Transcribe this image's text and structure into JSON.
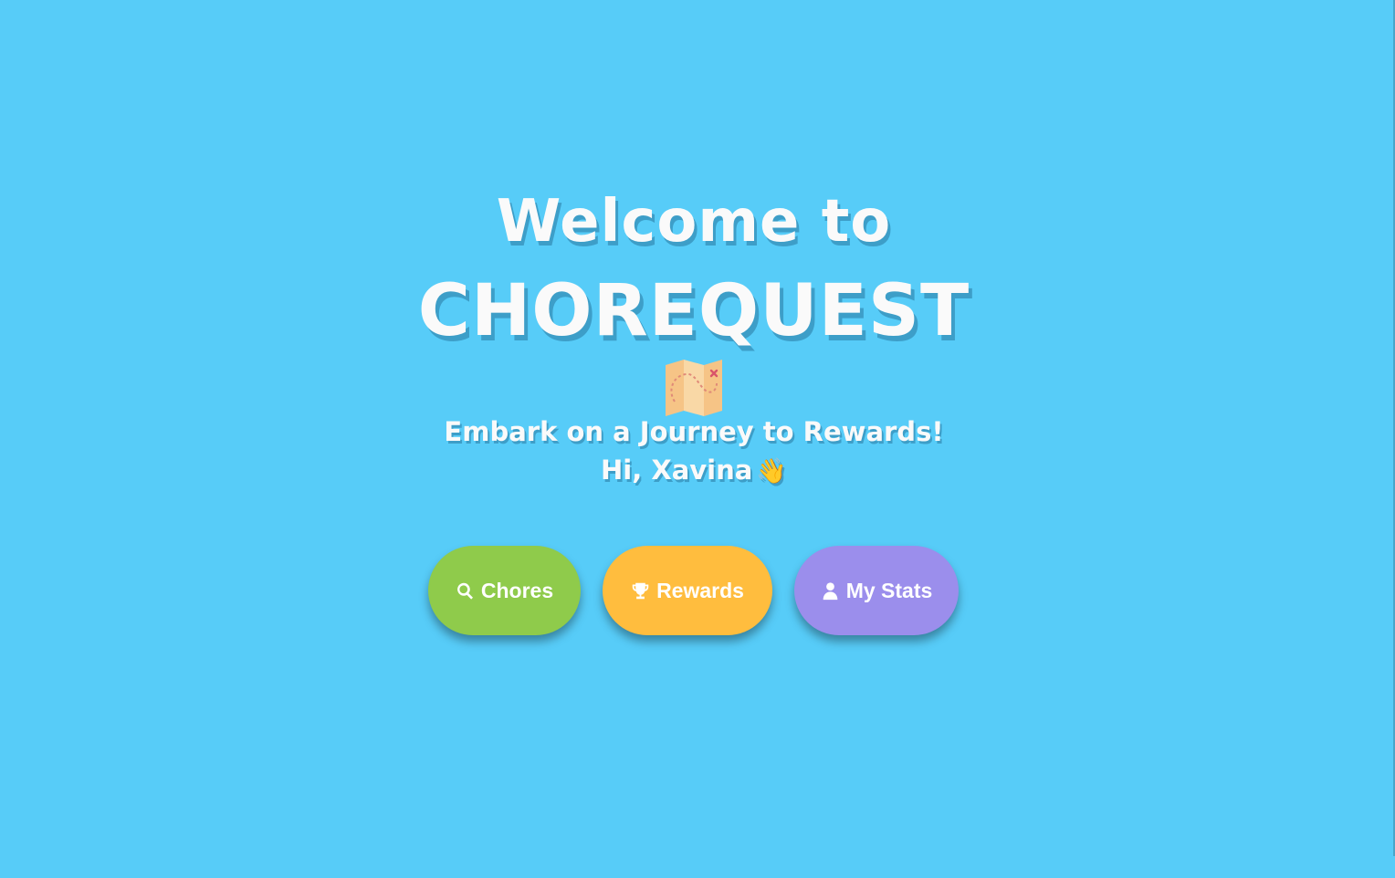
{
  "hero": {
    "welcome": "Welcome to",
    "brand": "CHOREQUEST",
    "tagline": "Embark on a Journey to Rewards!",
    "greeting": "Hi, Xavina",
    "greeting_emoji": "👋",
    "hero_icon": "treasure-map-icon"
  },
  "nav": {
    "chores": {
      "label": "Chores",
      "icon": "search-icon",
      "color": "#8fcb4b"
    },
    "rewards": {
      "label": "Rewards",
      "icon": "trophy-icon",
      "color": "#ffbd3e"
    },
    "stats": {
      "label": "My Stats",
      "icon": "user-icon",
      "color": "#9b8eec"
    }
  },
  "theme": {
    "background": "#57ccf8",
    "text": "#fafafa"
  }
}
